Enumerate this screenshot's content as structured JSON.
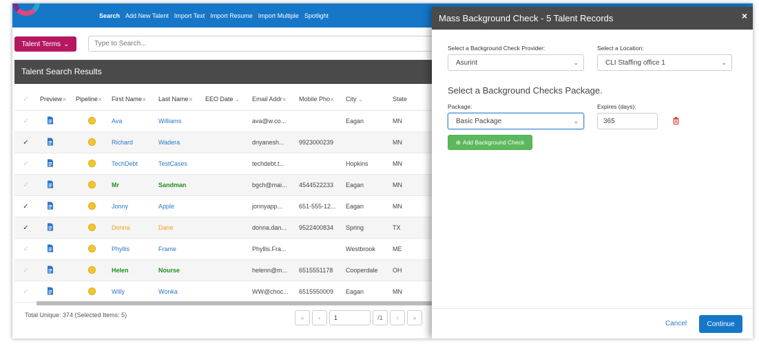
{
  "nav": {
    "links": [
      "Search",
      "Add New Talent",
      "Import Text",
      "Import Resume",
      "Import Multiple",
      "Spotlight"
    ]
  },
  "search": {
    "terms_label": "Talent Terms",
    "placeholder": "Type to Search..."
  },
  "results": {
    "title": "Talent Search Results",
    "columns": [
      "Preview",
      "Pipeline",
      "First Name",
      "Last Name",
      "EEO Date",
      "Email Addr",
      "Mobile Pho",
      "City",
      "State"
    ],
    "rows": [
      {
        "checked": false,
        "first": "Ava",
        "last": "Williams",
        "email": "ava@w.co...",
        "phone": "",
        "city": "Eagan",
        "state": "MN",
        "style": "blue"
      },
      {
        "checked": true,
        "first": "Richard",
        "last": "Wadera",
        "email": "dnyanesh...",
        "phone": "9923000239",
        "city": "",
        "state": "MN",
        "style": "blue"
      },
      {
        "checked": false,
        "first": "TechDebt",
        "last": "TestCases",
        "email": "techdebt.t...",
        "phone": "",
        "city": "Hopkins",
        "state": "MN",
        "style": "blue"
      },
      {
        "checked": false,
        "first": "Mr",
        "last": "Sandman",
        "email": "bgch@mai...",
        "phone": "4544522233",
        "city": "Eagan",
        "state": "MN",
        "style": "green"
      },
      {
        "checked": true,
        "first": "Jonny",
        "last": "Apple",
        "email": "jonnyapp...",
        "phone": "651-555-12...",
        "city": "Eagan",
        "state": "MN",
        "style": "blue"
      },
      {
        "checked": true,
        "first": "Donna",
        "last": "Dane",
        "email": "donna.dan...",
        "phone": "9522400834",
        "city": "Spring",
        "state": "TX",
        "style": "orange"
      },
      {
        "checked": false,
        "first": "Phyllis",
        "last": "Frame",
        "email": "Phyllis.Fra...",
        "phone": "",
        "city": "Westbrook",
        "state": "ME",
        "style": "blue"
      },
      {
        "checked": false,
        "first": "Helen",
        "last": "Nourse",
        "email": "helenn@m...",
        "phone": "6515551178",
        "city": "Cooperdale",
        "state": "OH",
        "style": "green"
      },
      {
        "checked": false,
        "first": "Willy",
        "last": "Wonka",
        "email": "WW@choc...",
        "phone": "6515550009",
        "city": "Eagan",
        "state": "MN",
        "style": "blue"
      }
    ],
    "total_text": "Total Unique: 374 (Selected Items: 5)",
    "pager": {
      "page": "1",
      "of": "/1"
    }
  },
  "modal": {
    "title": "Mass Background Check - 5 Talent Records",
    "close": "×",
    "provider_label": "Select a Background Check Provider:",
    "provider_value": "Asurint",
    "location_label": "Select a Location:",
    "location_value": "CLI Staffing office 1",
    "section_title": "Select a Background Checks Package.",
    "package_label": "Package:",
    "package_value": "Basic Package",
    "expires_label": "Expires (days):",
    "expires_value": "365",
    "add_button": "Add Background Check",
    "cancel": "Cancel",
    "continue": "Continue"
  },
  "colors": {
    "nav_blue": "#1677c9",
    "terms_magenta": "#b5185f",
    "header_gray": "#4a4a4a",
    "add_green": "#5cb85c",
    "link_blue": "#2b77c8",
    "name_green": "#1e8f1e",
    "name_orange": "#f0a012"
  }
}
